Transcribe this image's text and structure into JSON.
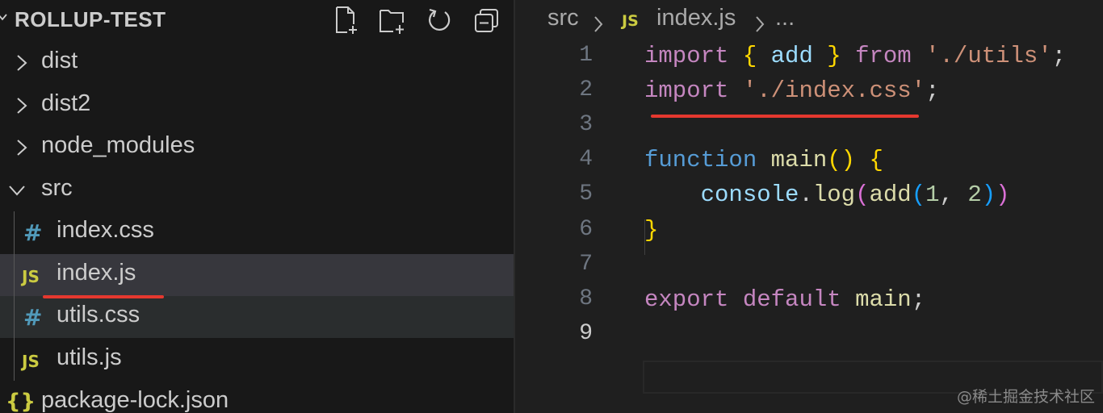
{
  "explorer": {
    "title": "ROLLUP-TEST",
    "actions": [
      {
        "name": "new-file-icon"
      },
      {
        "name": "new-folder-icon"
      },
      {
        "name": "refresh-icon"
      },
      {
        "name": "collapse-all-icon"
      }
    ],
    "items": [
      {
        "label": "dist",
        "type": "folder",
        "expanded": false
      },
      {
        "label": "dist2",
        "type": "folder",
        "expanded": false
      },
      {
        "label": "node_modules",
        "type": "folder",
        "expanded": false
      },
      {
        "label": "src",
        "type": "folder",
        "expanded": true
      },
      {
        "label": "index.css",
        "type": "file",
        "icon": "#",
        "icon_name": "css-file-icon"
      },
      {
        "label": "index.js",
        "type": "file",
        "icon": "JS",
        "icon_name": "js-file-icon",
        "selected": true
      },
      {
        "label": "utils.css",
        "type": "file",
        "icon": "#",
        "icon_name": "css-file-icon"
      },
      {
        "label": "utils.js",
        "type": "file",
        "icon": "JS",
        "icon_name": "js-file-icon"
      },
      {
        "label": "package-lock.json",
        "type": "file",
        "icon": "{}",
        "icon_name": "json-file-icon"
      }
    ]
  },
  "breadcrumb": {
    "folder": "src",
    "file_icon": "JS",
    "file": "index.js",
    "more": "..."
  },
  "editor": {
    "line_numbers": [
      "1",
      "2",
      "3",
      "4",
      "5",
      "6",
      "7",
      "8",
      "9"
    ],
    "active_line": "9",
    "lines": [
      [
        {
          "t": "import",
          "c": "kw"
        },
        {
          "t": " ",
          "c": ""
        },
        {
          "t": "{",
          "c": "b1"
        },
        {
          "t": " ",
          "c": ""
        },
        {
          "t": "add",
          "c": "var"
        },
        {
          "t": " ",
          "c": ""
        },
        {
          "t": "}",
          "c": "b1"
        },
        {
          "t": " ",
          "c": ""
        },
        {
          "t": "from",
          "c": "kw"
        },
        {
          "t": " ",
          "c": ""
        },
        {
          "t": "'./utils'",
          "c": "str"
        },
        {
          "t": ";",
          "c": ""
        }
      ],
      [
        {
          "t": "import",
          "c": "kw"
        },
        {
          "t": " ",
          "c": ""
        },
        {
          "t": "'./index.css'",
          "c": "str"
        },
        {
          "t": ";",
          "c": ""
        }
      ],
      [],
      [
        {
          "t": "function",
          "c": "fnkw"
        },
        {
          "t": " ",
          "c": ""
        },
        {
          "t": "main",
          "c": "fn"
        },
        {
          "t": "()",
          "c": "b1"
        },
        {
          "t": " ",
          "c": ""
        },
        {
          "t": "{",
          "c": "b1"
        }
      ],
      [
        {
          "t": "    ",
          "c": ""
        },
        {
          "t": "console",
          "c": "var"
        },
        {
          "t": ".",
          "c": ""
        },
        {
          "t": "log",
          "c": "fn"
        },
        {
          "t": "(",
          "c": "b2"
        },
        {
          "t": "add",
          "c": "fn"
        },
        {
          "t": "(",
          "c": "b3"
        },
        {
          "t": "1",
          "c": "num"
        },
        {
          "t": ", ",
          "c": ""
        },
        {
          "t": "2",
          "c": "num"
        },
        {
          "t": ")",
          "c": "b3"
        },
        {
          "t": ")",
          "c": "b2"
        }
      ],
      [
        {
          "t": "}",
          "c": "b1"
        }
      ],
      [],
      [
        {
          "t": "export",
          "c": "kw"
        },
        {
          "t": " ",
          "c": ""
        },
        {
          "t": "default",
          "c": "kw"
        },
        {
          "t": " ",
          "c": ""
        },
        {
          "t": "main",
          "c": "fn"
        },
        {
          "t": ";",
          "c": ""
        }
      ],
      []
    ]
  },
  "watermark": "@稀土掘金技术社区",
  "colors": {
    "annotation_red": "#e5382f",
    "selection_bg": "#37373d"
  }
}
